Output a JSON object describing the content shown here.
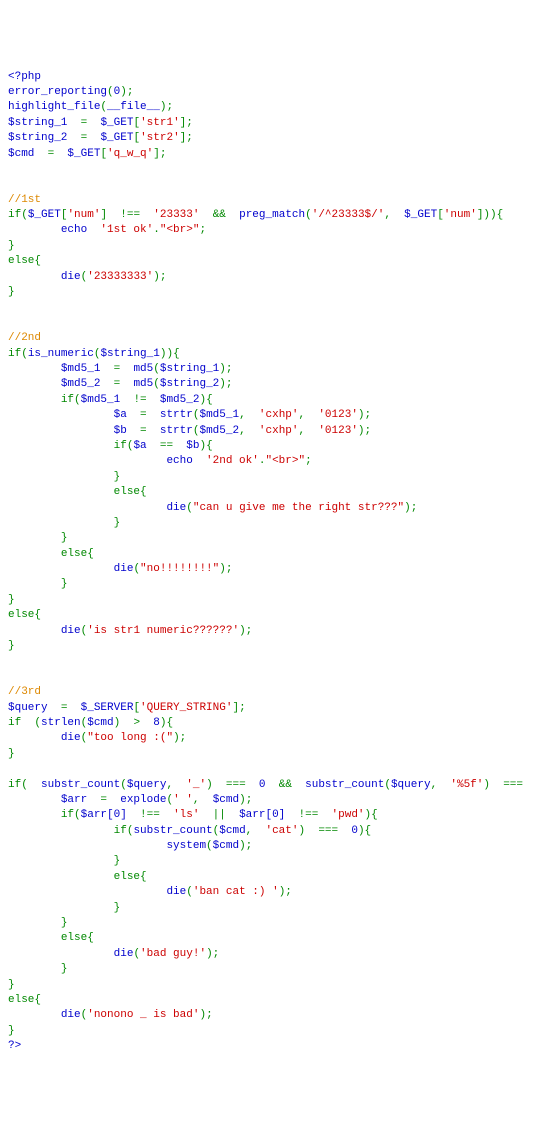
{
  "c": {
    "open_php": "<?php",
    "error_reporting": "error_reporting",
    "zero": "0",
    "highlight_file": "highlight_file",
    "file_const": "__file__",
    "string1var": "$string_1",
    "string2var": "$string_2",
    "cmdvar": "$cmd",
    "get": "$_GET",
    "str1key": "'str1'",
    "str2key": "'str2'",
    "qwqkey": "'q_w_q'",
    "c1": "//1st",
    "numkey": "'num'",
    "neq": "!==",
    "s23333": "'23333'",
    "amp": "&&",
    "preg_match": "preg_match",
    "regex23333": "'/^23333$/'",
    "echo": "echo",
    "s1stok": "'1st ok'",
    "br": "\"<br>\"",
    "elsek": "else",
    "die": "die",
    "s23333333": "'23333333'",
    "c2": "//2nd",
    "ifk": "if",
    "is_numeric": "is_numeric",
    "md5_1": "$md5_1",
    "md5_2": "$md5_2",
    "md5": "md5",
    "ne": "!=",
    "avar": "$a",
    "bvar": "$b",
    "strtr": "strtr",
    "cxhp": "'cxhp'",
    "s0123": "'0123'",
    "eqeq": "==",
    "s2ndok": "'2nd ok'",
    "scantgive": "\"can u give me the right str???\"",
    "sno": "\"no!!!!!!!!\"",
    "sisstr1": "'is str1 numeric??????'",
    "c3": "//3rd",
    "queryvar": "$query",
    "server": "$_SERVER",
    "qstrkey": "'QUERY_STRING'",
    "strlen": "strlen",
    "gt": ">",
    "eight": "8",
    "stoolong": "\"too long :(\"",
    "substr_count": "substr_count",
    "eqeqeq": "===",
    "sunder": "'_'",
    "s5f": "'%5f'",
    "arrvar": "$arr",
    "explode": "explode",
    "sspace": "' '",
    "arr0": "$arr[0]",
    "sls": "'ls'",
    "or": "||",
    "spwd": "'pwd'",
    "scat": "'cat'",
    "system": "system",
    "sbancat": "'ban cat :) '",
    "sbadguy": "'bad guy!'",
    "snonono": "'nonono _ is bad'",
    "close_php": "?>",
    "eq": "=",
    "semi": ";",
    "lparen": "(",
    "rparen": ")",
    "lbrack": "[",
    "rbrack": "]",
    "lbrace": "{",
    "rbrace": "}",
    "comma": ",",
    "dot": "."
  }
}
